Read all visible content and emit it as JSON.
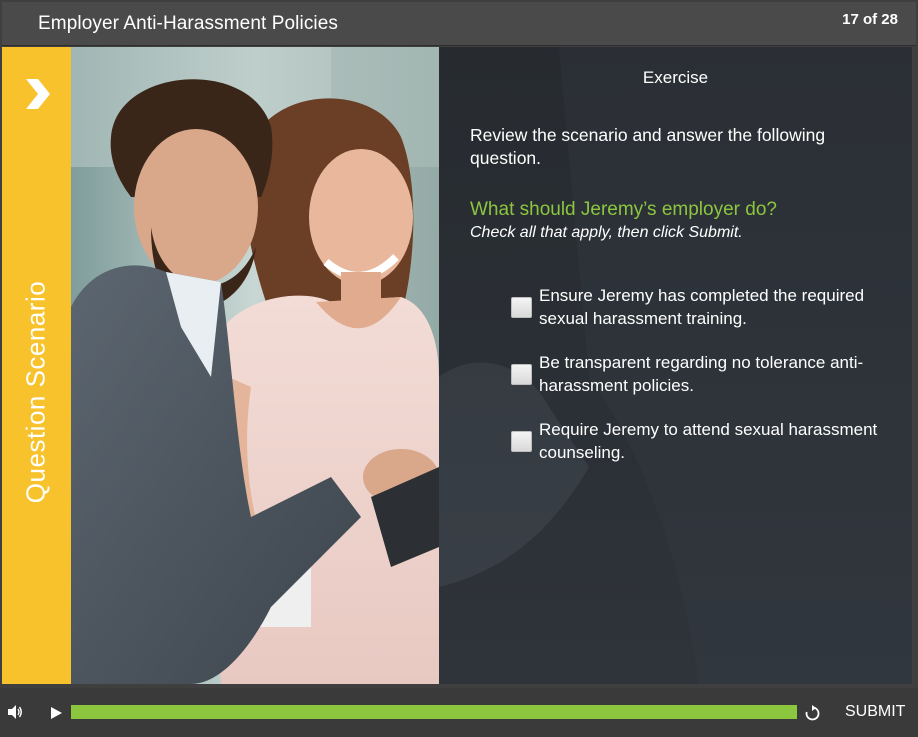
{
  "header": {
    "title": "Employer Anti-Harassment Policies",
    "slide_counter": "17 of 28"
  },
  "side_tab": {
    "label": "Question Scenario",
    "icon": "chevron-right-icon",
    "color": "#f7c22b"
  },
  "panel": {
    "title": "Exercise",
    "instructions": "Review the scenario and answer the following question.",
    "question": "What should Jeremy’s employer do?",
    "hint": "Check all that apply, then click Submit.",
    "question_color": "#8cc63f",
    "options": [
      {
        "label": "Ensure Jeremy has completed the required sexual harassment training.",
        "checked": false
      },
      {
        "label": "Be transparent regarding no tolerance anti-harassment policies.",
        "checked": false
      },
      {
        "label": "Require Jeremy to attend sexual harassment counseling.",
        "checked": false
      }
    ]
  },
  "controls": {
    "volume_icon": "volume-icon",
    "play_icon": "play-icon",
    "replay_icon": "replay-icon",
    "progress_fraction": 1.0,
    "progress_color": "#8cc63f",
    "submit_label": "SUBMIT"
  }
}
